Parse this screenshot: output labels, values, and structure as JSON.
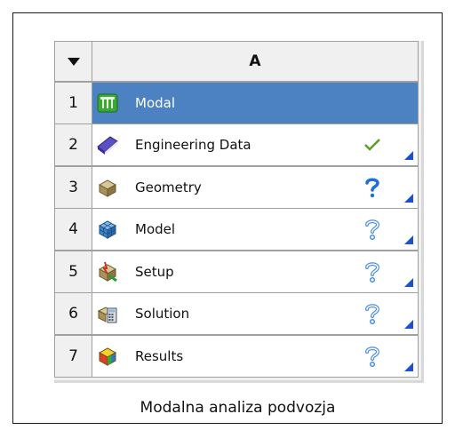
{
  "system": {
    "column_header": "A",
    "caption": "Modalna analiza podvozja",
    "rows": [
      {
        "num": "1",
        "label": "Modal",
        "icon": "modal-icon",
        "status": "none"
      },
      {
        "num": "2",
        "label": "Engineering Data",
        "icon": "engineering-data-icon",
        "status": "up-to-date"
      },
      {
        "num": "3",
        "label": "Geometry",
        "icon": "geometry-icon",
        "status": "attention-required"
      },
      {
        "num": "4",
        "label": "Model",
        "icon": "model-icon",
        "status": "unfulfilled"
      },
      {
        "num": "5",
        "label": "Setup",
        "icon": "setup-icon",
        "status": "unfulfilled"
      },
      {
        "num": "6",
        "label": "Solution",
        "icon": "solution-icon",
        "status": "unfulfilled"
      },
      {
        "num": "7",
        "label": "Results",
        "icon": "results-icon",
        "status": "unfulfilled"
      }
    ]
  },
  "colors": {
    "selected_row": "#4d82c2",
    "check": "#5aa02c",
    "question_solid": "#1e6fd9",
    "question_outline": "#4a8fe0",
    "corner": "#1a4fd6"
  }
}
